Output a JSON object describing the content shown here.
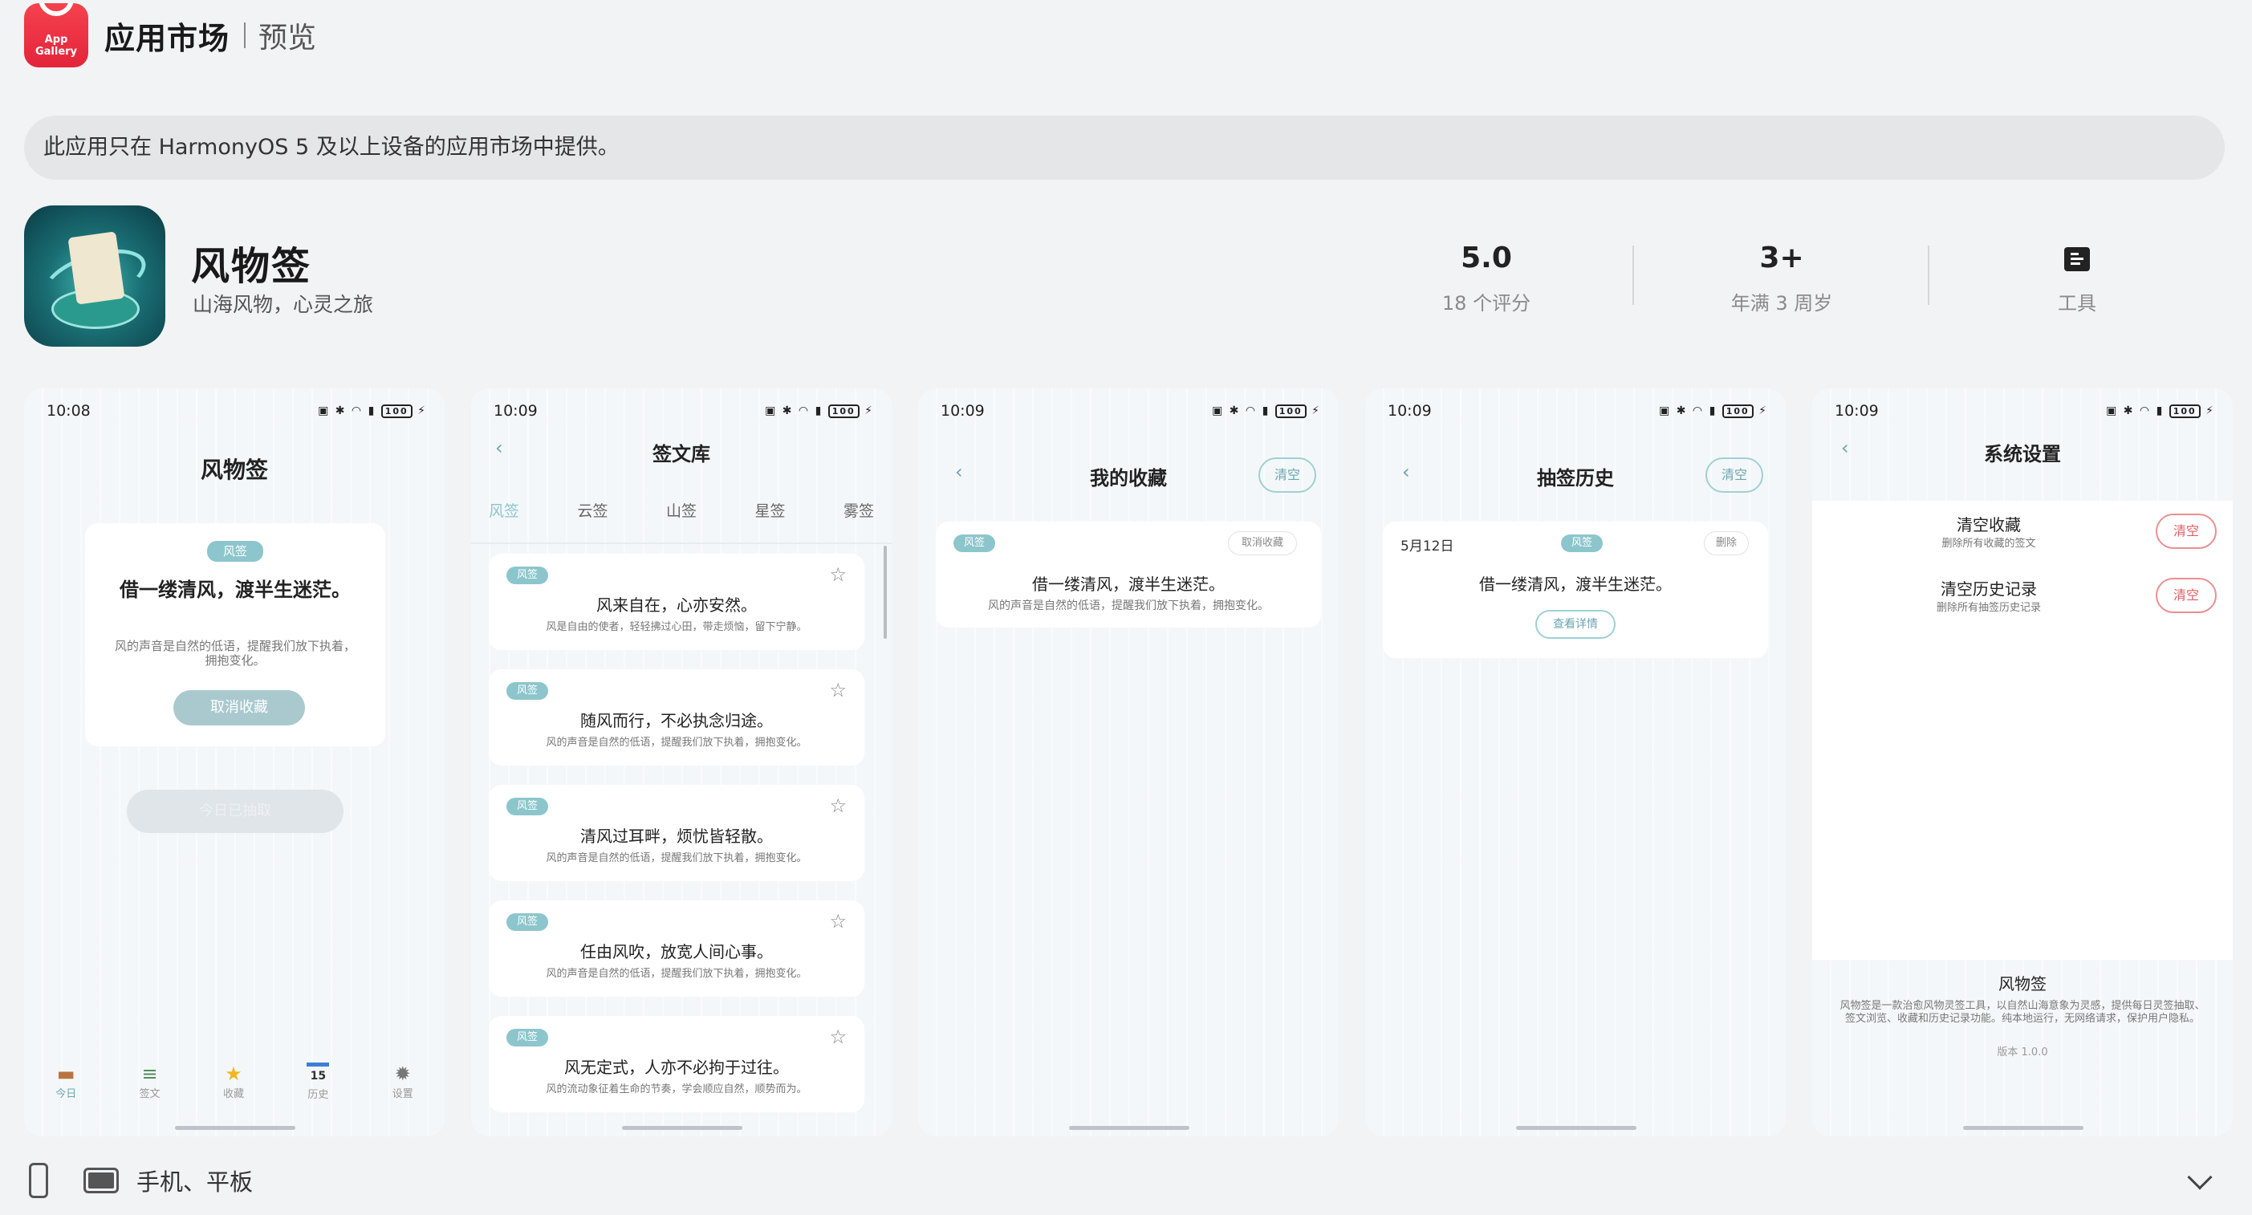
{
  "header": {
    "logo_text": "App\nGallery",
    "title": "应用市场",
    "subtitle": "预览"
  },
  "notice": "此应用只在 HarmonyOS 5 及以上设备的应用市场中提供。",
  "app": {
    "name": "风物签",
    "slogan": "山海风物，心灵之旅",
    "icon": "app-icon-scroll-globe"
  },
  "stats": [
    {
      "value": "5.0",
      "label": "18 个评分"
    },
    {
      "value": "3+",
      "label": "年满 3 周岁"
    },
    {
      "value": "",
      "label": "工具",
      "icon": "tool-icon"
    }
  ],
  "battery": "100",
  "shots": [
    {
      "time": "10:08",
      "title": "风物签",
      "tag": "风签",
      "sign": "借一缕清风，渡半生迷茫。",
      "desc": "风的声音是自然的低语，提醒我们放下执着，拥抱变化。",
      "btn_uncollect": "取消收藏",
      "btn_drawn": "今日已抽取",
      "tabs": [
        {
          "label": "今日",
          "icon": "calendar-icon"
        },
        {
          "label": "签文",
          "icon": "books-icon"
        },
        {
          "label": "收藏",
          "icon": "star-icon"
        },
        {
          "label": "历史",
          "icon": "date-icon",
          "badge": "15"
        },
        {
          "label": "设置",
          "icon": "gear-icon"
        }
      ]
    },
    {
      "time": "10:09",
      "title": "签文库",
      "categories": [
        "风签",
        "云签",
        "山签",
        "星签",
        "雾签"
      ],
      "items": [
        {
          "tag": "风签",
          "title": "风来自在，心亦安然。",
          "desc": "风是自由的使者，轻轻拂过心田，带走烦恼，留下宁静。"
        },
        {
          "tag": "风签",
          "title": "随风而行，不必执念归途。",
          "desc": "风的声音是自然的低语，提醒我们放下执着，拥抱变化。"
        },
        {
          "tag": "风签",
          "title": "清风过耳畔，烦忧皆轻散。",
          "desc": "风的声音是自然的低语，提醒我们放下执着，拥抱变化。"
        },
        {
          "tag": "风签",
          "title": "任由风吹，放宽人间心事。",
          "desc": "风的声音是自然的低语，提醒我们放下执着，拥抱变化。"
        },
        {
          "tag": "风签",
          "title": "风无定式，人亦不必拘于过往。",
          "desc": "风的流动象征着生命的节奏，学会顺应自然，顺势而为。"
        }
      ]
    },
    {
      "time": "10:09",
      "title": "我的收藏",
      "clear": "清空",
      "tag": "风签",
      "uncollect": "取消收藏",
      "sign": "借一缕清风，渡半生迷茫。",
      "desc": "风的声音是自然的低语，提醒我们放下执着，拥抱变化。"
    },
    {
      "time": "10:09",
      "title": "抽签历史",
      "clear": "清空",
      "date": "5月12日",
      "tag": "风签",
      "delete": "删除",
      "sign": "借一缕清风，渡半生迷茫。",
      "detail": "查看详情"
    },
    {
      "time": "10:09",
      "title": "系统设置",
      "rows": [
        {
          "title": "清空收藏",
          "desc": "删除所有收藏的签文",
          "btn": "清空"
        },
        {
          "title": "清空历史记录",
          "desc": "删除所有抽签历史记录",
          "btn": "清空"
        }
      ],
      "about_title": "风物签",
      "about_desc": "风物签是一款治愈风物灵签工具，以自然山海意象为灵感，提供每日灵签抽取、签文浏览、收藏和历史记录功能。纯本地运行，无网络请求，保护用户隐私。",
      "version": "版本 1.0.0"
    }
  ],
  "footer": {
    "devices": "手机、平板"
  }
}
